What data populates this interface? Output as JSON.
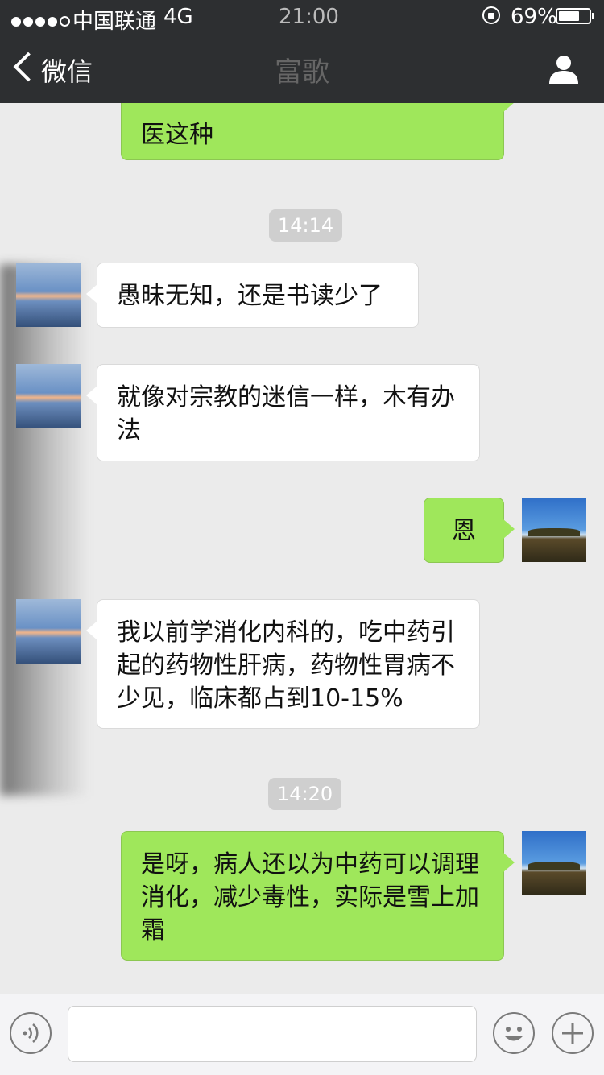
{
  "status_bar": {
    "carrier": "中国联通",
    "network": "4G",
    "time": "21:00",
    "battery_percent": "69%",
    "battery_level": 0.69,
    "signal_bars_filled": 4,
    "signal_bars_total": 5
  },
  "nav": {
    "back_label": "微信",
    "title": "富歌",
    "back_icon": "chevron-left-icon",
    "profile_icon": "person-icon"
  },
  "chat": {
    "timestamps": [
      "14:14",
      "14:20"
    ],
    "messages": [
      {
        "direction": "outgoing",
        "text": "医这种"
      },
      {
        "direction": "incoming",
        "text": "愚昧无知，还是书读少了"
      },
      {
        "direction": "incoming",
        "text": "就像对宗教的迷信一样，木有办法"
      },
      {
        "direction": "outgoing",
        "text": "恩"
      },
      {
        "direction": "incoming",
        "text": "我以前学消化内科的，吃中药引起的药物性肝病，药物性胃病不少见，临床都占到10-15%"
      },
      {
        "direction": "outgoing",
        "text": "是呀，病人还以为中药可以调理消化，减少毒性，实际是雪上加霜"
      }
    ]
  },
  "input_bar": {
    "voice_icon": "voice-icon",
    "emoji_icon": "smiley-icon",
    "plus_icon": "plus-icon",
    "message_value": ""
  },
  "colors": {
    "header_bg": "#2d2f31",
    "chat_bg": "#ebebeb",
    "outgoing_bubble": "#9fe75b",
    "incoming_bubble": "#ffffff",
    "timestamp_bg": "#cfcfcf"
  }
}
